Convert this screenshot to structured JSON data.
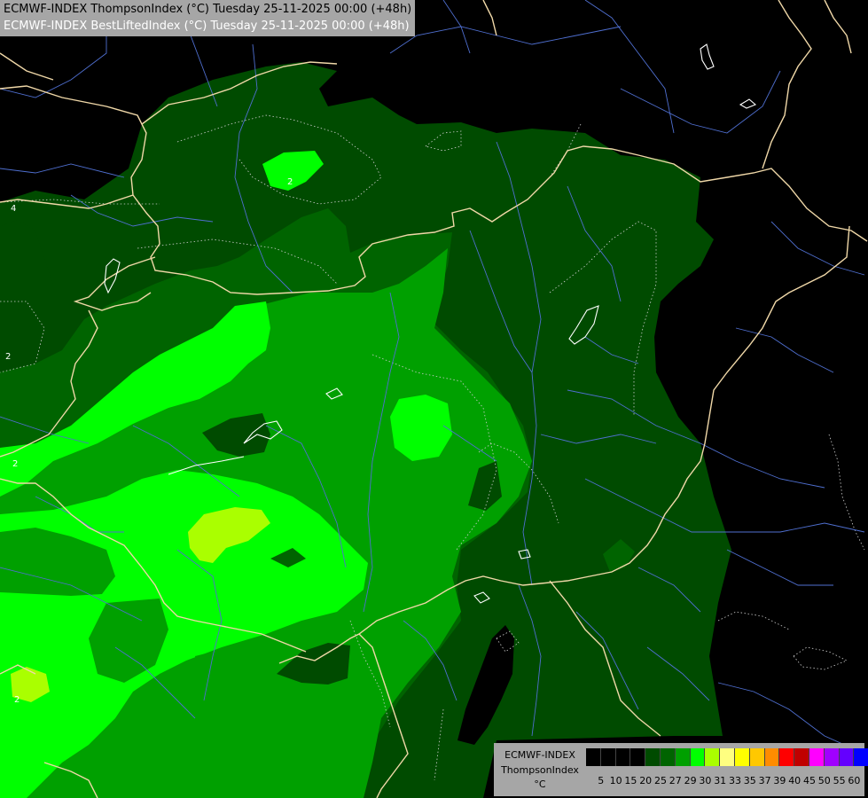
{
  "title": {
    "line1": "ECMWF-INDEX ThompsonIndex (°C) Tuesday 25-11-2025 00:00 (+48h)",
    "line2": "ECMWF-INDEX BestLiftedIndex (°C) Tuesday 25-11-2025 00:00 (+48h)"
  },
  "legend": {
    "model": "ECMWF-INDEX",
    "parameter": "ThompsonIndex",
    "unit": "°C",
    "ticks": [
      "5",
      "10",
      "15",
      "20",
      "25",
      "27",
      "29",
      "30",
      "31",
      "33",
      "35",
      "37",
      "39",
      "40",
      "45",
      "50",
      "55",
      "60"
    ],
    "colors": [
      "#000000",
      "#000000",
      "#000000",
      "#000000",
      "#004b00",
      "#006400",
      "#00a000",
      "#00ff00",
      "#aaff00",
      "#ffff80",
      "#ffff00",
      "#ffc800",
      "#ff8c00",
      "#ff0000",
      "#c00000",
      "#ff00ff",
      "#a000ff",
      "#6400ff",
      "#0000ff"
    ]
  },
  "contour_labels": [
    "2",
    "4",
    "2",
    "2",
    "2"
  ]
}
